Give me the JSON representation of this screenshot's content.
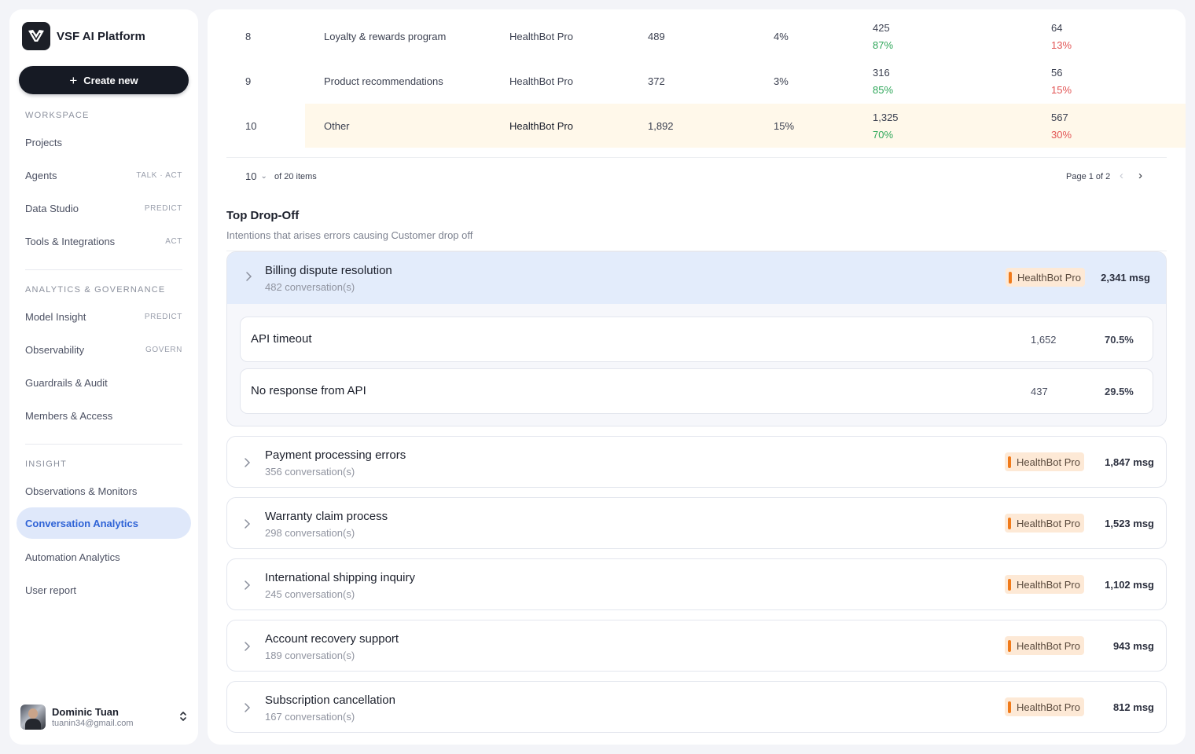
{
  "sidebar": {
    "brand": "VSF AI Platform",
    "create_label": "Create new",
    "sections": {
      "workspace": "WORKSPACE",
      "analytics": "ANALYTICS & GOVERNANCE",
      "insight": "INSIGHT"
    },
    "items": [
      {
        "label": "Projects",
        "tag": ""
      },
      {
        "label": "Agents",
        "tag": "TALK · ACT"
      },
      {
        "label": "Data Studio",
        "tag": "PREDICT"
      },
      {
        "label": "Tools & Integrations",
        "tag": "ACT"
      },
      {
        "label": "Model Insight",
        "tag": "PREDICT"
      },
      {
        "label": "Observability",
        "tag": "GOVERN"
      },
      {
        "label": "Guardrails & Audit",
        "tag": ""
      },
      {
        "label": "Members & Access",
        "tag": ""
      },
      {
        "label": "Observations & Monitors",
        "tag": ""
      },
      {
        "label": "Conversation Analytics",
        "tag": ""
      },
      {
        "label": "Automation Analytics",
        "tag": ""
      },
      {
        "label": "User report",
        "tag": ""
      }
    ],
    "active_item": "Conversation Analytics",
    "user": {
      "name": "Dominic Tuan",
      "email": "tuanin34@gmail.com"
    }
  },
  "table": {
    "rows": [
      {
        "rank": "8",
        "intent": "Loyalty & rewards program",
        "bot": "HealthBot Pro",
        "count": "489",
        "share": "4%",
        "success": "425",
        "success_pct": "87%",
        "fail": "64",
        "fail_pct": "13%"
      },
      {
        "rank": "9",
        "intent": "Product recommendations",
        "bot": "HealthBot Pro",
        "count": "372",
        "share": "3%",
        "success": "316",
        "success_pct": "85%",
        "fail": "56",
        "fail_pct": "15%"
      },
      {
        "rank": "10",
        "intent": "Other",
        "bot": "HealthBot Pro",
        "count": "1,892",
        "share": "15%",
        "success": "1,325",
        "success_pct": "70%",
        "fail": "567",
        "fail_pct": "30%"
      }
    ],
    "pagination": {
      "page_size": "10",
      "total_label": "of 20 items",
      "page_label": "Page 1 of 2"
    }
  },
  "dropoff": {
    "title": "Top Drop-Off",
    "subtitle": "Intentions that arises errors causing Customer drop off",
    "expanded": {
      "title": "Billing dispute resolution",
      "conversations": "482 conversation(s)",
      "bot": "HealthBot Pro",
      "messages": "2,341 msg",
      "reasons": [
        {
          "label": "API timeout",
          "count": "1,652",
          "pct": "70.5%"
        },
        {
          "label": "No response from API",
          "count": "437",
          "pct": "29.5%"
        }
      ]
    },
    "groups": [
      {
        "title": "Payment processing errors",
        "conversations": "356 conversation(s)",
        "bot": "HealthBot Pro",
        "messages": "1,847 msg"
      },
      {
        "title": "Warranty claim process",
        "conversations": "298 conversation(s)",
        "bot": "HealthBot Pro",
        "messages": "1,523 msg"
      },
      {
        "title": "International shipping inquiry",
        "conversations": "245 conversation(s)",
        "bot": "HealthBot Pro",
        "messages": "1,102 msg"
      },
      {
        "title": "Account recovery support",
        "conversations": "189 conversation(s)",
        "bot": "HealthBot Pro",
        "messages": "943 msg"
      },
      {
        "title": "Subscription cancellation",
        "conversations": "167 conversation(s)",
        "bot": "HealthBot Pro",
        "messages": "812 msg"
      }
    ]
  },
  "colors": {
    "accent": "#2f63d6",
    "positive": "#2fa75a",
    "negative": "#e25555",
    "chip_bg": "#fde9d6",
    "chip_bar": "#f07a1a"
  },
  "icons": [
    "vsf-logo-icon",
    "plus-icon",
    "chevron-down-icon",
    "chevron-left-icon",
    "chevron-right-icon",
    "expand-collapse-icon"
  ]
}
